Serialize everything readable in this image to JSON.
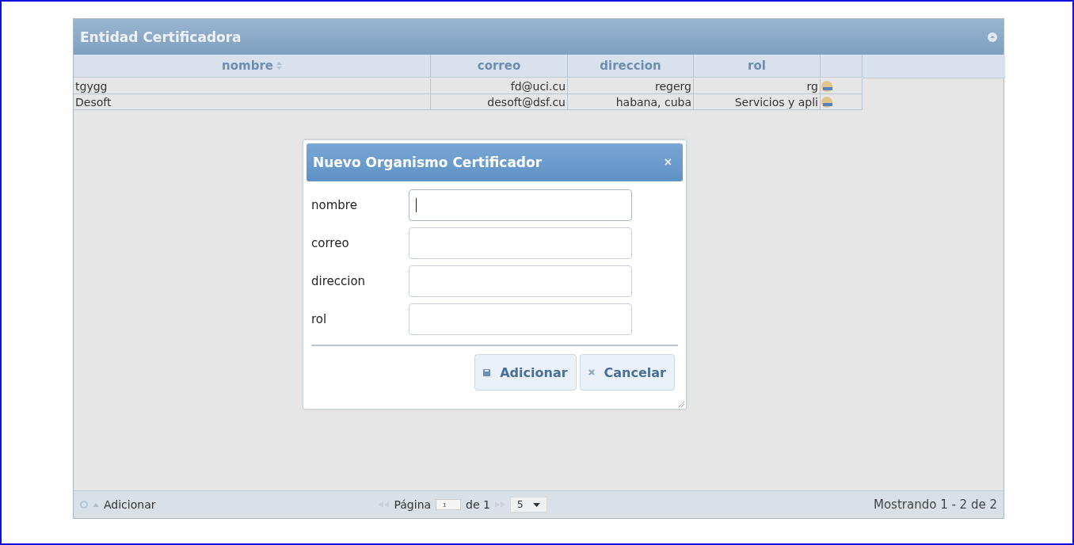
{
  "panel": {
    "title": "Entidad Certificadora"
  },
  "table": {
    "columns": [
      {
        "label": "nombre",
        "sortable": true
      },
      {
        "label": "correo",
        "sortable": false
      },
      {
        "label": "direccion",
        "sortable": false
      },
      {
        "label": "rol",
        "sortable": false
      }
    ],
    "rows": [
      {
        "cells": [
          "tgygg",
          "fd@uci.cu",
          "regerg",
          "rg"
        ]
      },
      {
        "cells": [
          "Desoft",
          "desoft@dsf.cu",
          "habana, cuba",
          "Servicios y apli"
        ]
      }
    ]
  },
  "dialog": {
    "title": "Nuevo Organismo Certificador",
    "close": "×",
    "fields": [
      {
        "label": "nombre",
        "focused": true
      },
      {
        "label": "correo",
        "focused": false
      },
      {
        "label": "direccion",
        "focused": false
      },
      {
        "label": "rol",
        "focused": false
      }
    ],
    "buttons": [
      {
        "label": "Adicionar",
        "kind": "save"
      },
      {
        "label": "Cancelar",
        "kind": "cancel"
      }
    ]
  },
  "pager": {
    "add_label": "Adicionar",
    "page_label": "Página",
    "page_value": "1",
    "page_total": "de 1",
    "page_size": "5",
    "status": "Mostrando 1 - 2 de 2"
  }
}
